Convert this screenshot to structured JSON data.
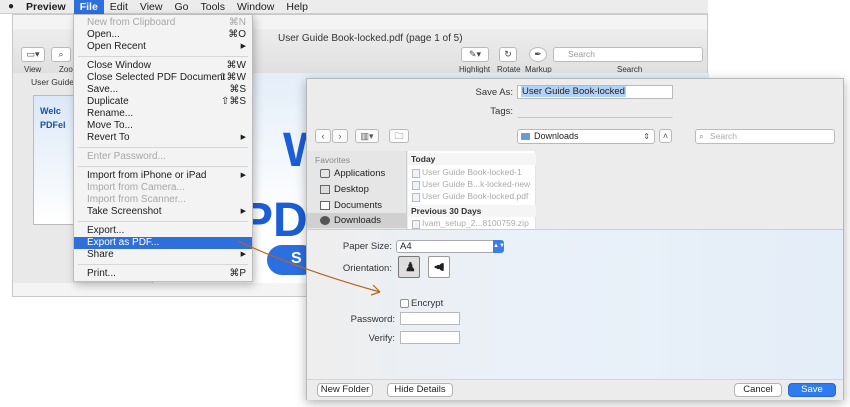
{
  "menubar": {
    "apple_icon": "apple-logo-icon",
    "app_name": "Preview",
    "menus": [
      {
        "label": "File",
        "active": true
      },
      {
        "label": "Edit"
      },
      {
        "label": "View"
      },
      {
        "label": "Go"
      },
      {
        "label": "Tools"
      },
      {
        "label": "Window"
      },
      {
        "label": "Help"
      }
    ]
  },
  "preview_window": {
    "title": "User Guide Book-locked.pdf (page 1 of 5)",
    "toolbar": {
      "view_label": "View",
      "zoom_label": "Zoo",
      "highlight_label": "Highlight",
      "rotate_label": "Rotate",
      "markup_label": "Markup",
      "search_label": "Search",
      "search_placeholder": "Search"
    },
    "sidebar_item": "User Guide B",
    "thumbnail": {
      "line1": "Welc",
      "line2": "PDFel"
    },
    "doc_letters": {
      "w": "W",
      "pdf": "PDF",
      "s": "S"
    }
  },
  "file_menu": {
    "items": [
      {
        "label": "New from Clipboard",
        "shortcut": "⌘N",
        "disabled": true
      },
      {
        "label": "Open...",
        "shortcut": "⌘O"
      },
      {
        "label": "Open Recent",
        "submenu": true
      },
      {
        "label": "Close Window",
        "shortcut": "⌘W"
      },
      {
        "label": "Close Selected PDF Document",
        "shortcut": "⇧⌘W"
      },
      {
        "label": "Save...",
        "shortcut": "⌘S"
      },
      {
        "label": "Duplicate",
        "shortcut": "⇧⌘S"
      },
      {
        "label": "Rename..."
      },
      {
        "label": "Move To..."
      },
      {
        "label": "Revert To",
        "submenu": true
      },
      {
        "label": "Enter Password...",
        "disabled": true
      },
      {
        "label": "Import from iPhone or iPad",
        "submenu": true
      },
      {
        "label": "Import from Camera...",
        "disabled": true
      },
      {
        "label": "Import from Scanner...",
        "disabled": true
      },
      {
        "label": "Take Screenshot",
        "submenu": true
      },
      {
        "label": "Export..."
      },
      {
        "label": "Export as PDF...",
        "selected": true
      },
      {
        "label": "Share",
        "submenu": true
      },
      {
        "label": "Print...",
        "shortcut": "⌘P"
      }
    ]
  },
  "save_dialog": {
    "save_as_label": "Save As:",
    "save_as_value": "User Guide Book-locked",
    "tags_label": "Tags:",
    "location": "Downloads",
    "search_placeholder": "Search",
    "favorites_header": "Favorites",
    "sidebar": [
      {
        "label": "Applications",
        "icon": "applications-icon"
      },
      {
        "label": "Desktop",
        "icon": "desktop-icon"
      },
      {
        "label": "Documents",
        "icon": "documents-icon"
      },
      {
        "label": "Downloads",
        "icon": "downloads-icon",
        "selected": true
      }
    ],
    "files": {
      "today_header": "Today",
      "today": [
        "User Guide Book-locked-1",
        "User Guide B...k-locked-new",
        "User Guide Book-locked.pdf"
      ],
      "previous_header": "Previous 30 Days",
      "previous": [
        "Ivam_setup_2...8100759.zip"
      ]
    },
    "paper_size_label": "Paper Size:",
    "paper_size_value": "A4",
    "orientation_label": "Orientation:",
    "encrypt_label": "Encrypt",
    "password_label": "Password:",
    "verify_label": "Verify:",
    "new_folder_label": "New Folder",
    "hide_details_label": "Hide Details",
    "cancel_label": "Cancel",
    "save_label": "Save"
  },
  "colors": {
    "accent": "#2f6fdc",
    "primary_button": "#2f7cf0",
    "annotation_arrow": "#b5651d"
  }
}
